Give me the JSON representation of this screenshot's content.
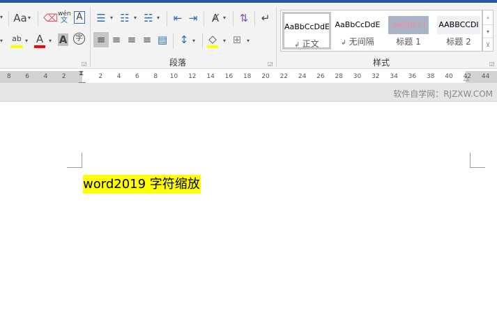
{
  "ribbon": {
    "font_row1": {
      "change_case": "Aa",
      "phonetic_top": "wén",
      "phonetic_bottom": "文",
      "char_border": "A"
    },
    "font_row2": {
      "highlight": "ab",
      "font_color": "A",
      "char_shading": "A",
      "enclose": "字"
    },
    "highlight_color": "#ffff00",
    "font_color_value": "#ff0000",
    "paragraph_label": "段落",
    "styles_label": "样式",
    "styles": [
      {
        "preview": "AaBbCcDdE",
        "name": "正文",
        "mark": "↲"
      },
      {
        "preview": "AaBbCcDdE",
        "name": "无间隔",
        "mark": "↲"
      },
      {
        "preview": "AABBCCI",
        "name": "标题 1"
      },
      {
        "preview": "AABBCCDI",
        "name": "标题 2"
      }
    ]
  },
  "ruler": {
    "left": [
      "8",
      "6",
      "4",
      "2"
    ],
    "main": [
      "2",
      "4",
      "6",
      "8",
      "10",
      "12",
      "14",
      "16",
      "18",
      "20",
      "22",
      "24",
      "26",
      "28",
      "30",
      "32",
      "34",
      "36",
      "38",
      "40"
    ],
    "right": [
      "42",
      "44"
    ]
  },
  "watermark": "软件自学网：RJZXW.COM",
  "document": {
    "text": "word2019 字符缩放",
    "highlight": "#ffff00"
  }
}
